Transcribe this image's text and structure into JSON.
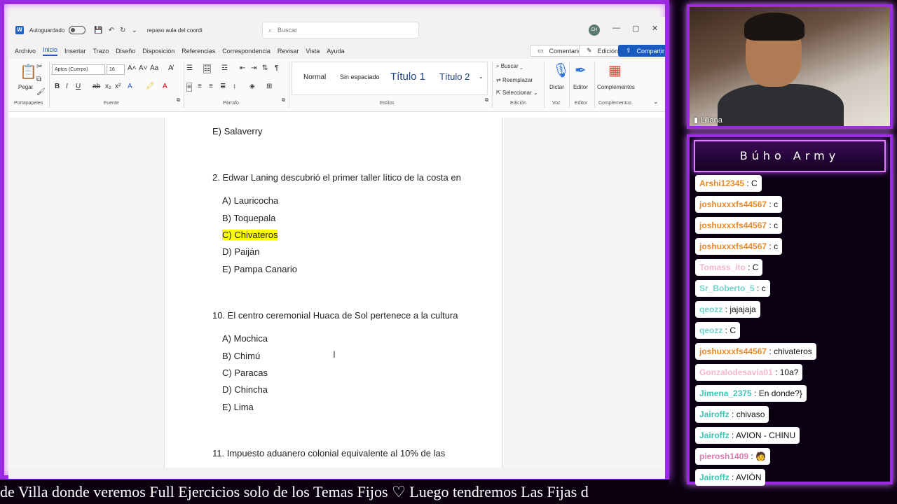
{
  "word": {
    "autosave_label": "Autoguardado",
    "doc_name": "repaso aula del coordi",
    "search_placeholder": "Buscar",
    "avatar_initials": "EH",
    "menu": [
      "Archivo",
      "Inicio",
      "Insertar",
      "Trazo",
      "Diseño",
      "Disposición",
      "Referencias",
      "Correspondencia",
      "Revisar",
      "Vista",
      "Ayuda"
    ],
    "comments_btn": "Comentarios",
    "edit_btn": "Edición",
    "share_btn": "Compartir",
    "ribbon": {
      "paste": "Pegar",
      "portapapeles": "Portapapeles",
      "font_name": "Aptos (Cuerpo)",
      "font_size": "16",
      "fuente": "Fuente",
      "parrafo": "Párrafo",
      "styles": [
        "Normal",
        "Sin espaciado",
        "Título 1",
        "Título 2"
      ],
      "estilos": "Estilos",
      "buscar": "Buscar",
      "reemplazar": "Reemplazar",
      "seleccionar": "Seleccionar",
      "edicion": "Edición",
      "dictar": "Dictar",
      "voz": "Voz",
      "editor": "Editor",
      "editor_grp": "Editor",
      "complementos": "Complementos",
      "complementos_grp": "Complementos"
    },
    "doc_lines": {
      "l0": "E) Salaverry",
      "q2": "2. Edwar Laning descubrió el primer taller lítico de la costa en",
      "q2a": "A) Lauricocha",
      "q2b": "B) Toquepala",
      "q2c": "C) Chivateros",
      "q2d": "D) Paiján",
      "q2e": "E) Pampa Canario",
      "q10": "10. El centro ceremonial Huaca de Sol pertenece a la cultura",
      "q10a": "A) Mochica",
      "q10b": "B) Chimú",
      "q10c": "C) Paracas",
      "q10d": "D) Chincha",
      "q10e": "E) Lima",
      "q11": "11.  Impuesto aduanero colonial equivalente al 10% de las"
    }
  },
  "ticker_text": "de Villa donde veremos Full Ejercicios solo de los Temas Fijos   ♡   Luego tendremos Las Fijas d",
  "camera": {
    "name": "Liliana"
  },
  "chat": {
    "title": "Búho Army",
    "messages": [
      {
        "user": "Arshi12345",
        "text": "C",
        "color": "#e8892a"
      },
      {
        "user": "joshuxxxfs44567",
        "text": "c",
        "color": "#e8892a"
      },
      {
        "user": "joshuxxxfs44567",
        "text": "c",
        "color": "#e8892a"
      },
      {
        "user": "joshuxxxfs44567",
        "text": "c",
        "color": "#e8892a"
      },
      {
        "user": "Tomass_ito",
        "text": "C",
        "color": "#f4b6c8"
      },
      {
        "user": "Sr_Boberto_5",
        "text": "c",
        "color": "#6fd3c8"
      },
      {
        "user": "qeozz",
        "text": "jajajaja",
        "color": "#6fd3c8"
      },
      {
        "user": "qeozz",
        "text": "C",
        "color": "#6fd3c8"
      },
      {
        "user": "joshuxxxfs44567",
        "text": "chivateros",
        "color": "#e8892a"
      },
      {
        "user": "Gonzalodesavia01",
        "text": "10a?",
        "color": "#f4b6c8"
      },
      {
        "user": "Jimena_2375",
        "text": "En donde?}",
        "color": "#3cc5b5"
      },
      {
        "user": "Jairoffz",
        "text": "chivaso",
        "color": "#3cc5b5"
      },
      {
        "user": "Jairoffz",
        "text": "AVION - CHINU",
        "color": "#3cc5b5"
      },
      {
        "user": "pierosh1409",
        "text": "",
        "color": "#e07ab0"
      },
      {
        "user": "Jairoffz",
        "text": "AVIÓN",
        "color": "#3cc5b5"
      }
    ]
  }
}
